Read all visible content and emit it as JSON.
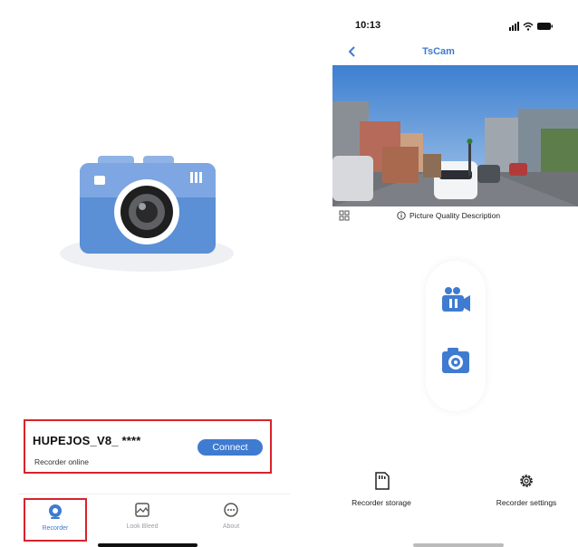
{
  "left_screen": {
    "device_card": {
      "name": "HUPEJOS_V8_ ****",
      "status": "Recorder online",
      "connect_label": "Connect"
    },
    "tabs": [
      {
        "label": "Recorder",
        "icon": "recorder-icon",
        "active": true
      },
      {
        "label": "Look Bleed",
        "icon": "gallery-icon",
        "active": false
      },
      {
        "label": "About",
        "icon": "about-icon",
        "active": false
      }
    ]
  },
  "right_screen": {
    "status_bar": {
      "time": "10:13"
    },
    "nav": {
      "title": "TsCam",
      "back_icon": "chevron-left-icon"
    },
    "preview": {
      "quality_label": "Picture Quality Description"
    },
    "controls": {
      "record_icon": "pause-video-icon",
      "photo_icon": "camera-capture-icon"
    },
    "bottom_actions": [
      {
        "label": "Recorder storage",
        "icon": "sd-card-icon"
      },
      {
        "label": "Recorder settings",
        "icon": "gear-icon"
      }
    ]
  },
  "colors": {
    "accent": "#3f7bd1",
    "highlight_border": "#d8232a",
    "camera_blue": "#5b8fd6"
  }
}
